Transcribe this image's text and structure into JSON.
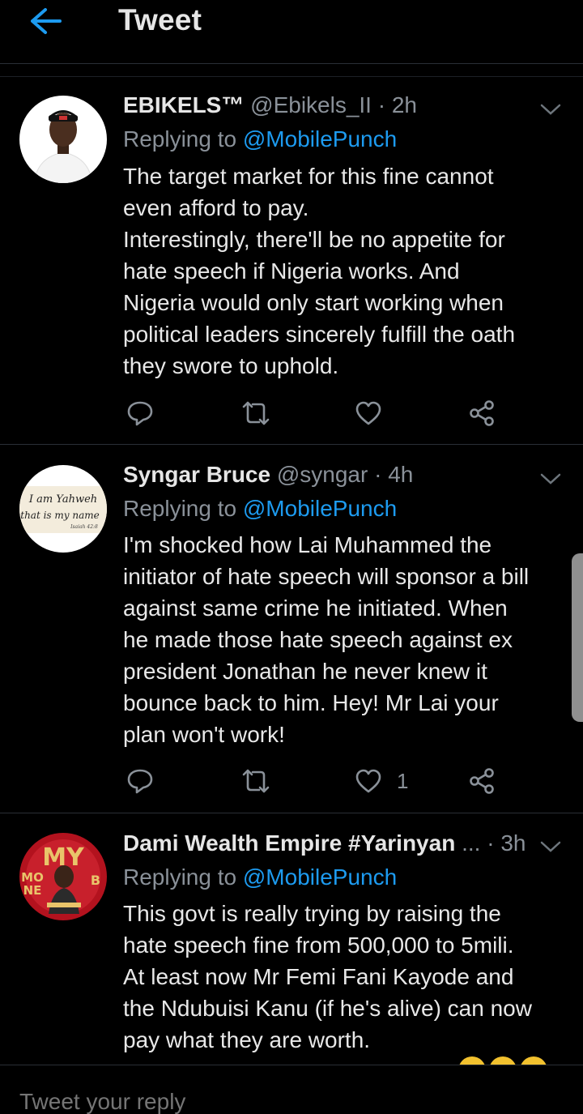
{
  "header": {
    "title": "Tweet"
  },
  "tweets": [
    {
      "name": "EBIKELS™",
      "handle": "@Ebikels_II · 2h",
      "replying_prefix": "Replying to ",
      "replying_to": "@MobilePunch",
      "text": "The target market for this fine cannot\neven afford to pay.\nInterestingly, there'll be no appetite for\nhate speech if Nigeria works. And\nNigeria would only start working when\npolitical leaders sincerely fulfill the oath\nthey swore to uphold.",
      "like_count": ""
    },
    {
      "name": "Syngar Bruce",
      "handle": "@syngar · 4h",
      "replying_prefix": "Replying to ",
      "replying_to": "@MobilePunch",
      "text": "I'm shocked how Lai Muhammed the\ninitiator of hate speech will sponsor a bill\nagainst same crime he initiated. When\nhe made those hate speech against ex\npresident Jonathan he never knew it\nbounce back to him. Hey! Mr Lai your\nplan won't work!",
      "like_count": "1",
      "avatar_text_line1": "I am Yahweh",
      "avatar_text_line2": "that is my name",
      "avatar_text_line3": "Isaiah 42:8"
    },
    {
      "name": "Dami Wealth Empire #Yarinyan",
      "handle": "... · 3h",
      "replying_prefix": "Replying to ",
      "replying_to": "@MobilePunch",
      "text": "This govt is really trying by raising the\nhate speech fine from 500,000 to 5mili.\nAt least now Mr Femi Fani Kayode and\nthe Ndubuisi Kanu (if he's alive) can now\npay what they are worth.",
      "avatar_text_top": "MY",
      "avatar_text_left": "MO",
      "avatar_text_left2": "NE",
      "avatar_text_right": "B"
    }
  ],
  "compose": {
    "placeholder": "Tweet your reply"
  },
  "colors": {
    "accent": "#1d9bf0",
    "background": "#000000",
    "muted": "#8a9199"
  }
}
